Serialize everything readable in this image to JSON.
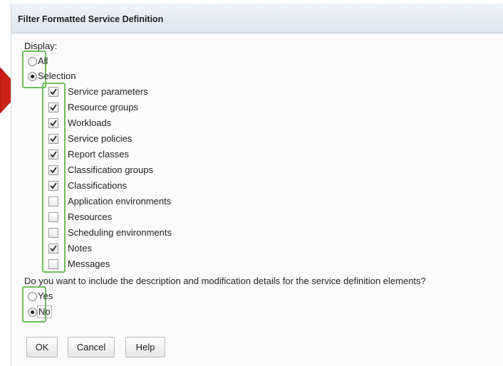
{
  "dialog": {
    "title": "Filter Formatted Service Definition"
  },
  "display": {
    "label": "Display:",
    "options": [
      {
        "label": "All",
        "selected": false
      },
      {
        "label": "Selection",
        "selected": true
      }
    ]
  },
  "selection_items": [
    {
      "label": "Service parameters",
      "checked": true
    },
    {
      "label": "Resource groups",
      "checked": true
    },
    {
      "label": "Workloads",
      "checked": true
    },
    {
      "label": "Service policies",
      "checked": true
    },
    {
      "label": "Report classes",
      "checked": true
    },
    {
      "label": "Classification groups",
      "checked": true
    },
    {
      "label": "Classifications",
      "checked": true
    },
    {
      "label": "Application environments",
      "checked": false
    },
    {
      "label": "Resources",
      "checked": false
    },
    {
      "label": "Scheduling environments",
      "checked": false
    },
    {
      "label": "Notes",
      "checked": true
    },
    {
      "label": "Messages",
      "checked": false
    }
  ],
  "details_question": {
    "label": "Do you want to include the description and modification details for the service definition elements?",
    "options": [
      {
        "label": "Yes",
        "selected": false
      },
      {
        "label": "No",
        "selected": true
      }
    ]
  },
  "buttons": {
    "ok": "OK",
    "cancel": "Cancel",
    "help": "Help"
  },
  "colors": {
    "highlight_box": "#6cbf5a",
    "pointer_arrow": "#cc2216"
  }
}
